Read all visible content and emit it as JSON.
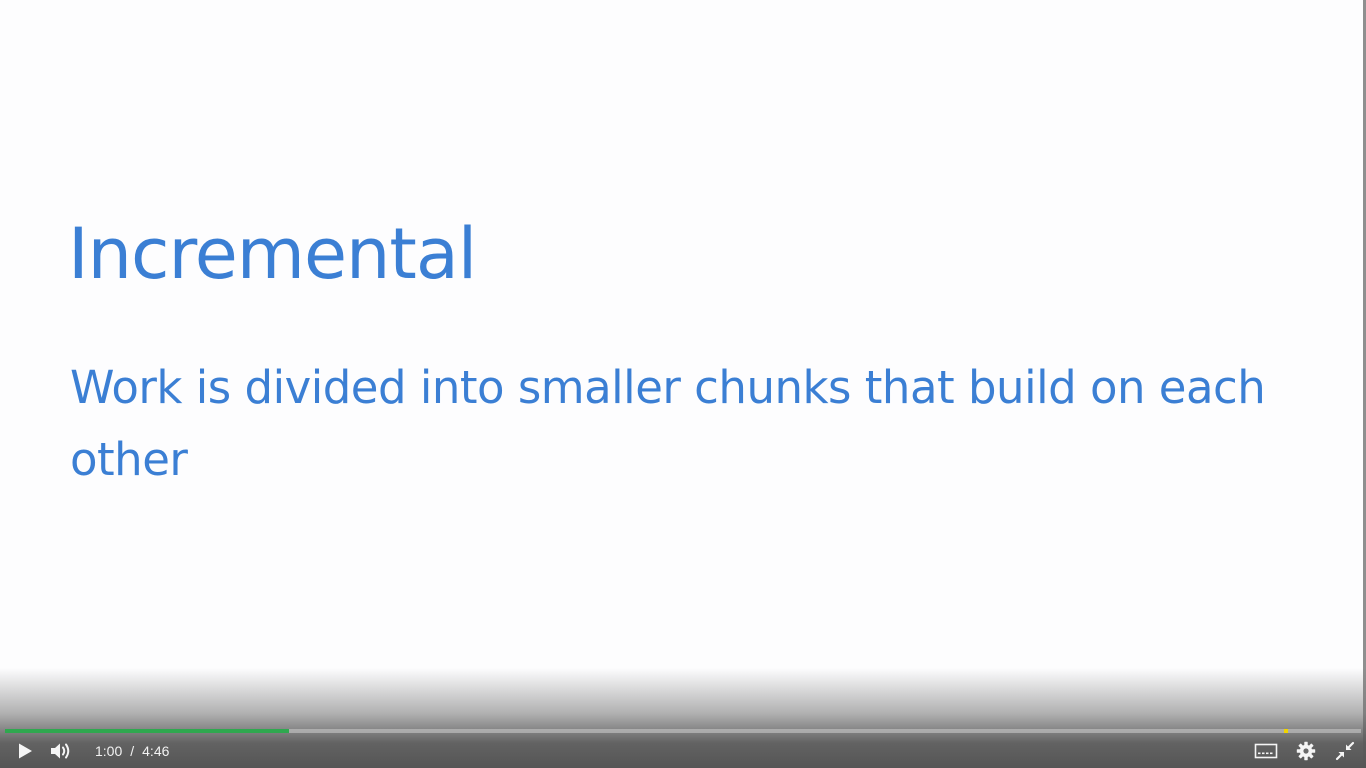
{
  "slide": {
    "title": "Incremental",
    "body": "Work is divided into smaller chunks that build on each other",
    "text_color": "#3b7fd4",
    "background": "#fdfdfe"
  },
  "player": {
    "current_time": "1:00",
    "separator": "/",
    "duration": "4:46",
    "progress_played_fraction": 0.2098,
    "progress_played_color": "#2fa84f",
    "progress_marker_color": "#f0d400",
    "icons": {
      "play": "play-icon",
      "volume": "volume-icon",
      "captions": "captions-icon",
      "settings": "gear-icon",
      "exit_fullscreen": "exit-fullscreen-icon"
    }
  }
}
